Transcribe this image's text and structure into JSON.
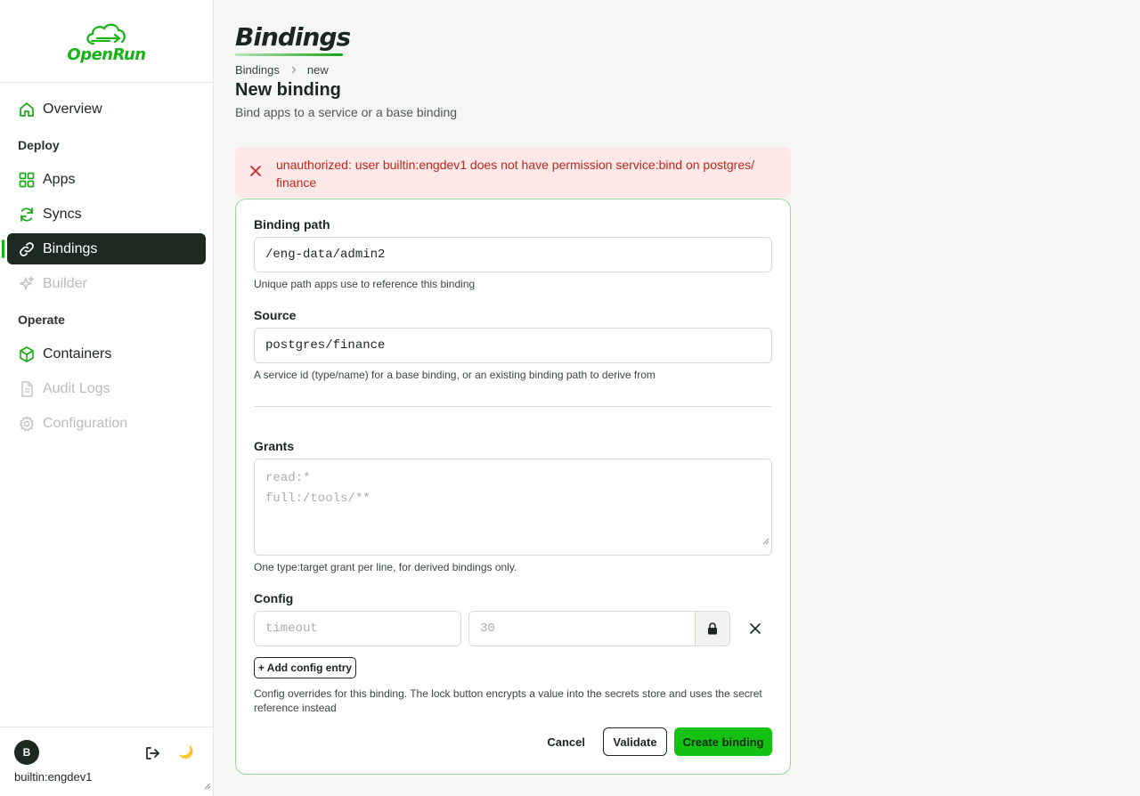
{
  "brand": {
    "name": "OpenRun",
    "color": "#17b317"
  },
  "sidebar": {
    "items": [
      {
        "label": "Overview",
        "icon": "home-icon",
        "state": "normal"
      },
      {
        "section": "Deploy"
      },
      {
        "label": "Apps",
        "icon": "grid-icon",
        "state": "normal"
      },
      {
        "label": "Syncs",
        "icon": "refresh-icon",
        "state": "normal"
      },
      {
        "label": "Bindings",
        "icon": "link-icon",
        "state": "active"
      },
      {
        "label": "Builder",
        "icon": "sparkle-icon",
        "state": "disabled"
      },
      {
        "section": "Operate"
      },
      {
        "label": "Containers",
        "icon": "cube-icon",
        "state": "normal"
      },
      {
        "label": "Audit Logs",
        "icon": "document-icon",
        "state": "disabled"
      },
      {
        "label": "Configuration",
        "icon": "gear-icon",
        "state": "disabled"
      }
    ],
    "sections": {
      "deploy": "Deploy",
      "operate": "Operate"
    },
    "labels": {
      "overview": "Overview",
      "apps": "Apps",
      "syncs": "Syncs",
      "bindings": "Bindings",
      "builder": "Builder",
      "containers": "Containers",
      "audit_logs": "Audit Logs",
      "configuration": "Configuration"
    }
  },
  "user": {
    "avatar_letter": "B",
    "name": "builtin:engdev1"
  },
  "page": {
    "heading": "Bindings",
    "breadcrumb": [
      "Bindings",
      "new"
    ],
    "form_title": "New binding",
    "form_subtitle": "Bind apps to a service or a base binding"
  },
  "error": {
    "message": "unauthorized: user builtin:engdev1 does not have permission service:bind on postgres/finance",
    "line1": "unauthorized: user builtin:engdev1 does not have permission service:bind on postgres/",
    "line2": "finance"
  },
  "form": {
    "binding_path": {
      "label": "Binding path",
      "value": "/eng-data/admin2",
      "hint": "Unique path apps use to reference this binding"
    },
    "source": {
      "label": "Source",
      "value": "postgres/finance",
      "hint": "A service id (type/name) for a base binding, or an existing binding path to derive from"
    },
    "grants": {
      "label": "Grants",
      "placeholder": "read:*\nfull:/tools/**",
      "hint": "One type:target grant per line, for derived bindings only."
    },
    "config": {
      "label": "Config",
      "key_placeholder": "timeout",
      "value_placeholder": "30",
      "add_label": "+ Add config entry",
      "hint": "Config overrides for this binding. The lock button encrypts a value into the secrets store and uses the secret reference instead"
    },
    "actions": {
      "cancel": "Cancel",
      "validate": "Validate",
      "create": "Create binding"
    }
  },
  "colors": {
    "accent": "#14c214",
    "sidebar_active_bg": "#1d2a22",
    "error_bg": "#fce9e7",
    "error_text": "#c2261b"
  }
}
